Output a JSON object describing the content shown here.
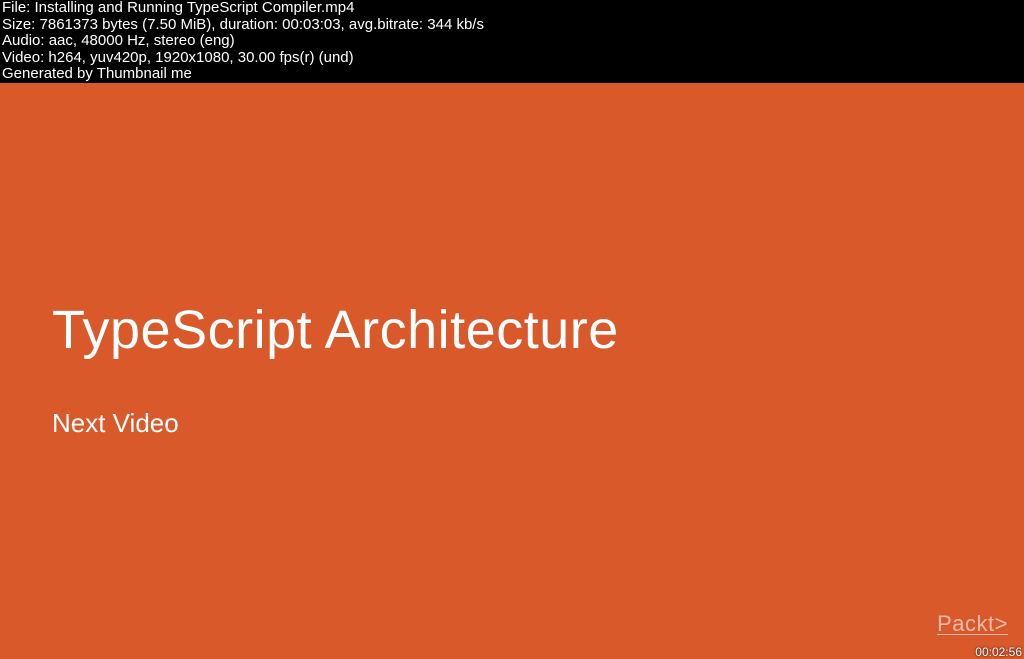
{
  "header": {
    "file": "File: Installing and Running TypeScript Compiler.mp4",
    "size": "Size: 7861373 bytes (7.50 MiB), duration: 00:03:03, avg.bitrate: 344 kb/s",
    "audio": "Audio: aac, 48000 Hz, stereo (eng)",
    "video": "Video: h264, yuv420p, 1920x1080, 30.00 fps(r) (und)",
    "generated": "Generated by Thumbnail me"
  },
  "slide": {
    "title": "TypeScript Architecture",
    "subtitle": "Next Video",
    "brand": "Packt>",
    "timestamp": "00:02:56"
  }
}
